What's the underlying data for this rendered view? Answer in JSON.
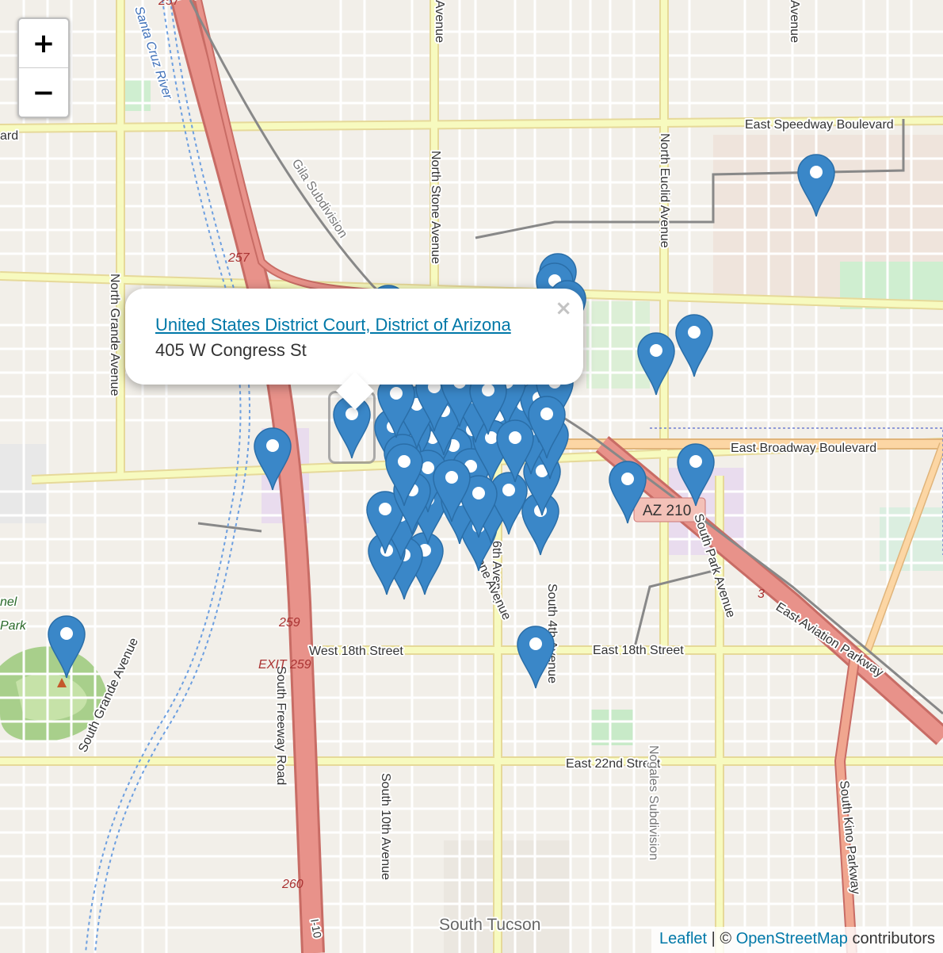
{
  "zoom": {
    "in_label": "+",
    "out_label": "−"
  },
  "popup": {
    "title": "United States District Court, District of Arizona",
    "address": "405 W Congress St",
    "close_label": "×"
  },
  "attribution": {
    "leaflet": "Leaflet",
    "separator": "| ©",
    "osm": "OpenStreetMap",
    "suffix": "contributors"
  },
  "labels": {
    "speedway": "East Speedway Boulevard",
    "broadway": "East Broadway Boulevard",
    "e18th": "East 18th Street",
    "w18th": "West 18th Street",
    "e22nd": "East 22nd Street",
    "stone": "North Stone Avenue",
    "euclid": "North Euclid Avenue",
    "grande_n": "North Grande Avenue",
    "grande_s": "South Grande Avenue",
    "freeway": "South Freeway Road",
    "tenth": "South 10th Avenue",
    "fourth": "South 4th Avenue",
    "sixth": "6th Avenue",
    "stone_s": "Stone Avenue",
    "park": "South Park Avenue",
    "kino": "South Kino Parkway",
    "aviation": "East Aviation Parkway",
    "nogales": "Nogales Subdivision",
    "gila": "Gila Subdivision",
    "santa_cruz": "Santa Cruz River",
    "south_tucson": "South Tucson",
    "avenue_top1": "Avenue",
    "avenue_top2": "Avenue",
    "park_label": "Park",
    "nel": "nel",
    "ard": "ard",
    "az210": "AZ 210",
    "i257a": "257",
    "i257b": "257",
    "i259": "259",
    "exit259": "EXIT 259",
    "i260": "260",
    "i10": "I-10",
    "num3": "3"
  },
  "colors": {
    "marker": "#3a87c8",
    "major_road": "#f7fabf",
    "highway": "#e8928a",
    "primary": "#fcd6a4"
  }
}
